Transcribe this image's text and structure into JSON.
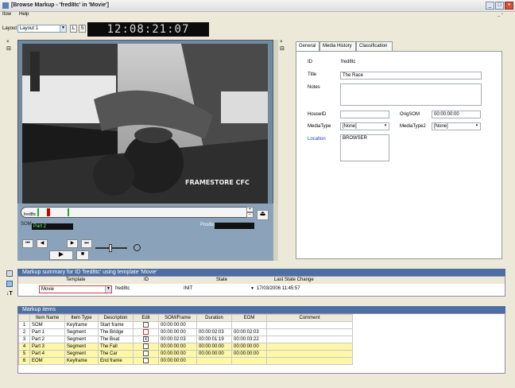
{
  "window": {
    "title": "[Browse Markup - 'fred8tc' in 'Movie']"
  },
  "menu": {
    "items": [
      "Itow",
      "Help"
    ]
  },
  "toolbar": {
    "layout_label": "Layout",
    "layout_value": "Layout 1",
    "btn_l": "L",
    "btn_s": "S"
  },
  "timecode": {
    "h": "12",
    "m": "08",
    "s": "21",
    "f": "07"
  },
  "video": {
    "watermark": "FRAMESTORE CFC"
  },
  "player": {
    "part_label": "Part 2",
    "position_label": "Position",
    "clip_label": "SOM",
    "timeline_label": "fred8tc"
  },
  "tabs": [
    {
      "label": "General"
    },
    {
      "label": "Media History"
    },
    {
      "label": "Classification"
    }
  ],
  "general": {
    "id_label": "ID",
    "id_value": "fred8tc",
    "title_label": "Title",
    "title_value": "The Race",
    "notes_label": "Notes",
    "notes_value": "",
    "houseid_label": "HouseID",
    "houseid_value": "",
    "origsom_label": "OrigSOM",
    "origsom_value": "00:00:00:00",
    "mediatype_label": "MediaType",
    "mediatype_value": "[None]",
    "mediatype2_label": "MediaType2",
    "mediatype2_value": "[None]",
    "location_label": "Location",
    "location_value": "BROWSER"
  },
  "markup_summary": {
    "title": "Markup summary for ID 'fred8tc' using template 'Movie'",
    "headers": [
      "Template",
      "ID",
      "State",
      "Last State Change"
    ],
    "row": {
      "template": "Movie",
      "id": "fred8tc",
      "state": "INIT",
      "last_change": "17/03/2006 11:45:57"
    }
  },
  "markup_items": {
    "title": "Markup items",
    "headers": [
      "Item Name",
      "Item Type",
      "Description",
      "Edit",
      "SOM/Frame",
      "Duration",
      "EOM",
      "Comment"
    ],
    "rows": [
      {
        "n": "1",
        "name": "SOM",
        "type": "Keyframe",
        "desc": "Start frame",
        "edit": "",
        "som": "00:00:00:00",
        "dur": "",
        "eom": "",
        "comment": "",
        "hl": false
      },
      {
        "n": "2",
        "name": "Part 1",
        "type": "Segment",
        "desc": "The Bridge",
        "edit": "",
        "som": "00:00:00:00",
        "dur": "00:00:02:03",
        "eom": "00:00:02:03",
        "comment": "",
        "hl": false
      },
      {
        "n": "3",
        "name": "Part 2",
        "type": "Segment",
        "desc": "The Boat",
        "edit": "x",
        "som": "00:00:02:03",
        "dur": "00:00:01:19",
        "eom": "00:00:03:22",
        "comment": "",
        "hl": false
      },
      {
        "n": "4",
        "name": "Part 3",
        "type": "Segment",
        "desc": "The Fall",
        "edit": "",
        "som": "00:00:00:00",
        "dur": "00:00:00:00",
        "eom": "00:00:00:00",
        "comment": "",
        "hl": true
      },
      {
        "n": "5",
        "name": "Part 4",
        "type": "Segment",
        "desc": "The Car",
        "edit": "",
        "som": "00:00:00:00",
        "dur": "00:00:00:00",
        "eom": "00:00:00:00",
        "comment": "",
        "hl": true
      },
      {
        "n": "6",
        "name": "EOM",
        "type": "Keyframe",
        "desc": "End frame",
        "edit": "",
        "som": "00:00:00:00",
        "dur": "",
        "eom": "",
        "comment": "",
        "hl": true
      }
    ]
  },
  "colors": {
    "accent": "#4b6fa3",
    "highlight": "#fdf7a8",
    "player": "#6f8aa3"
  },
  "icons": [
    "close-icon",
    "minimize-icon",
    "maximize-icon",
    "play-icon",
    "stop-icon",
    "pin-icon"
  ]
}
